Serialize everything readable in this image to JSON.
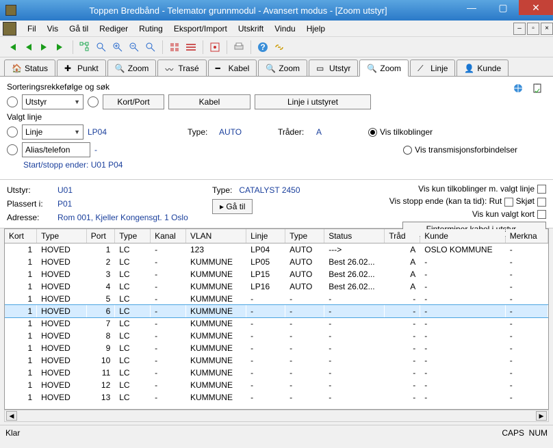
{
  "title": "Toppen Bredbånd - Telemator grunnmodul - Avansert modus - [Zoom utstyr]",
  "menu": [
    "Fil",
    "Vis",
    "Gå til",
    "Rediger",
    "Ruting",
    "Eksport/Import",
    "Utskrift",
    "Vindu",
    "Hjelp"
  ],
  "tabs": [
    {
      "label": "Status"
    },
    {
      "label": "Punkt"
    },
    {
      "label": "Zoom"
    },
    {
      "label": "Trasé"
    },
    {
      "label": "Kabel"
    },
    {
      "label": "Zoom"
    },
    {
      "label": "Utstyr"
    },
    {
      "label": "Zoom",
      "active": true
    },
    {
      "label": "Linje"
    },
    {
      "label": "Kunde"
    }
  ],
  "sort": {
    "title": "Sorteringsrekkefølge og søk",
    "utstyr": "Utstyr",
    "kortport_btn": "Kort/Port",
    "kabel_btn": "Kabel",
    "linjeutstyr_btn": "Linje i utstyret"
  },
  "valgt": {
    "title": "Valgt linje",
    "linje_label": "Linje",
    "linje_val": "LP04",
    "alias_label": "Alias/telefon",
    "alias_val": "-",
    "type_label": "Type:",
    "type_val": "AUTO",
    "trader_label": "Tråder:",
    "trader_val": "A",
    "startstop": "Start/stopp ender: U01  P04",
    "radio1": "Vis tilkoblinger",
    "radio2": "Vis transmisjonsforbindelser"
  },
  "info": {
    "utstyr_label": "Utstyr:",
    "utstyr_val": "U01",
    "plassert_label": "Plassert i:",
    "plassert_val": "P01",
    "adresse_label": "Adresse:",
    "adresse_val": "Rom 001, Kjeller Kongensgt. 1 Oslo",
    "type_label": "Type:",
    "type_val": "CATALYST 2450",
    "gatil_btn": "▸ Gå til",
    "right": {
      "l1": "Vis kun tilkoblinger m. valgt linje",
      "l2a": "Vis stopp ende (kan ta tid): Rut",
      "l2b": "Skjøt",
      "l3": "Vis kun valgt kort",
      "finterminer": "Finterminer kabel i utstyr..."
    }
  },
  "columns": [
    "Kort",
    "Type",
    "Port",
    "Type",
    "Kanal",
    "VLAN",
    "Linje",
    "Type",
    "Status",
    "Tråd",
    "Kunde",
    "Merkna"
  ],
  "rows": [
    {
      "kort": "1",
      "t1": "HOVED",
      "port": "1",
      "t2": "LC",
      "kanal": "-",
      "vlan": "123",
      "linje": "LP04",
      "t3": "AUTO",
      "status": "--->",
      "trad": "A",
      "kunde": "OSLO KOMMUNE",
      "merk": "-"
    },
    {
      "kort": "1",
      "t1": "HOVED",
      "port": "2",
      "t2": "LC",
      "kanal": "-",
      "vlan": "KUMMUNE",
      "linje": "LP05",
      "t3": "AUTO",
      "status": "Best 26.02...",
      "trad": "A",
      "kunde": "-",
      "merk": "-"
    },
    {
      "kort": "1",
      "t1": "HOVED",
      "port": "3",
      "t2": "LC",
      "kanal": "-",
      "vlan": "KUMMUNE",
      "linje": "LP15",
      "t3": "AUTO",
      "status": "Best 26.02...",
      "trad": "A",
      "kunde": "-",
      "merk": "-"
    },
    {
      "kort": "1",
      "t1": "HOVED",
      "port": "4",
      "t2": "LC",
      "kanal": "-",
      "vlan": "KUMMUNE",
      "linje": "LP16",
      "t3": "AUTO",
      "status": "Best 26.02...",
      "trad": "A",
      "kunde": "-",
      "merk": "-"
    },
    {
      "kort": "1",
      "t1": "HOVED",
      "port": "5",
      "t2": "LC",
      "kanal": "-",
      "vlan": "KUMMUNE",
      "linje": "-",
      "t3": "-",
      "status": "-",
      "trad": "-",
      "kunde": "-",
      "merk": "-"
    },
    {
      "kort": "1",
      "t1": "HOVED",
      "port": "6",
      "t2": "LC",
      "kanal": "-",
      "vlan": "KUMMUNE",
      "linje": "-",
      "t3": "-",
      "status": "-",
      "trad": "-",
      "kunde": "-",
      "merk": "-",
      "sel": true
    },
    {
      "kort": "1",
      "t1": "HOVED",
      "port": "7",
      "t2": "LC",
      "kanal": "-",
      "vlan": "KUMMUNE",
      "linje": "-",
      "t3": "-",
      "status": "-",
      "trad": "-",
      "kunde": "-",
      "merk": "-"
    },
    {
      "kort": "1",
      "t1": "HOVED",
      "port": "8",
      "t2": "LC",
      "kanal": "-",
      "vlan": "KUMMUNE",
      "linje": "-",
      "t3": "-",
      "status": "-",
      "trad": "-",
      "kunde": "-",
      "merk": "-"
    },
    {
      "kort": "1",
      "t1": "HOVED",
      "port": "9",
      "t2": "LC",
      "kanal": "-",
      "vlan": "KUMMUNE",
      "linje": "-",
      "t3": "-",
      "status": "-",
      "trad": "-",
      "kunde": "-",
      "merk": "-"
    },
    {
      "kort": "1",
      "t1": "HOVED",
      "port": "10",
      "t2": "LC",
      "kanal": "-",
      "vlan": "KUMMUNE",
      "linje": "-",
      "t3": "-",
      "status": "-",
      "trad": "-",
      "kunde": "-",
      "merk": "-"
    },
    {
      "kort": "1",
      "t1": "HOVED",
      "port": "11",
      "t2": "LC",
      "kanal": "-",
      "vlan": "KUMMUNE",
      "linje": "-",
      "t3": "-",
      "status": "-",
      "trad": "-",
      "kunde": "-",
      "merk": "-"
    },
    {
      "kort": "1",
      "t1": "HOVED",
      "port": "12",
      "t2": "LC",
      "kanal": "-",
      "vlan": "KUMMUNE",
      "linje": "-",
      "t3": "-",
      "status": "-",
      "trad": "-",
      "kunde": "-",
      "merk": "-"
    },
    {
      "kort": "1",
      "t1": "HOVED",
      "port": "13",
      "t2": "LC",
      "kanal": "-",
      "vlan": "KUMMUNE",
      "linje": "-",
      "t3": "-",
      "status": "-",
      "trad": "-",
      "kunde": "-",
      "merk": "-"
    }
  ],
  "status": {
    "klar": "Klar",
    "caps": "CAPS",
    "num": "NUM"
  }
}
